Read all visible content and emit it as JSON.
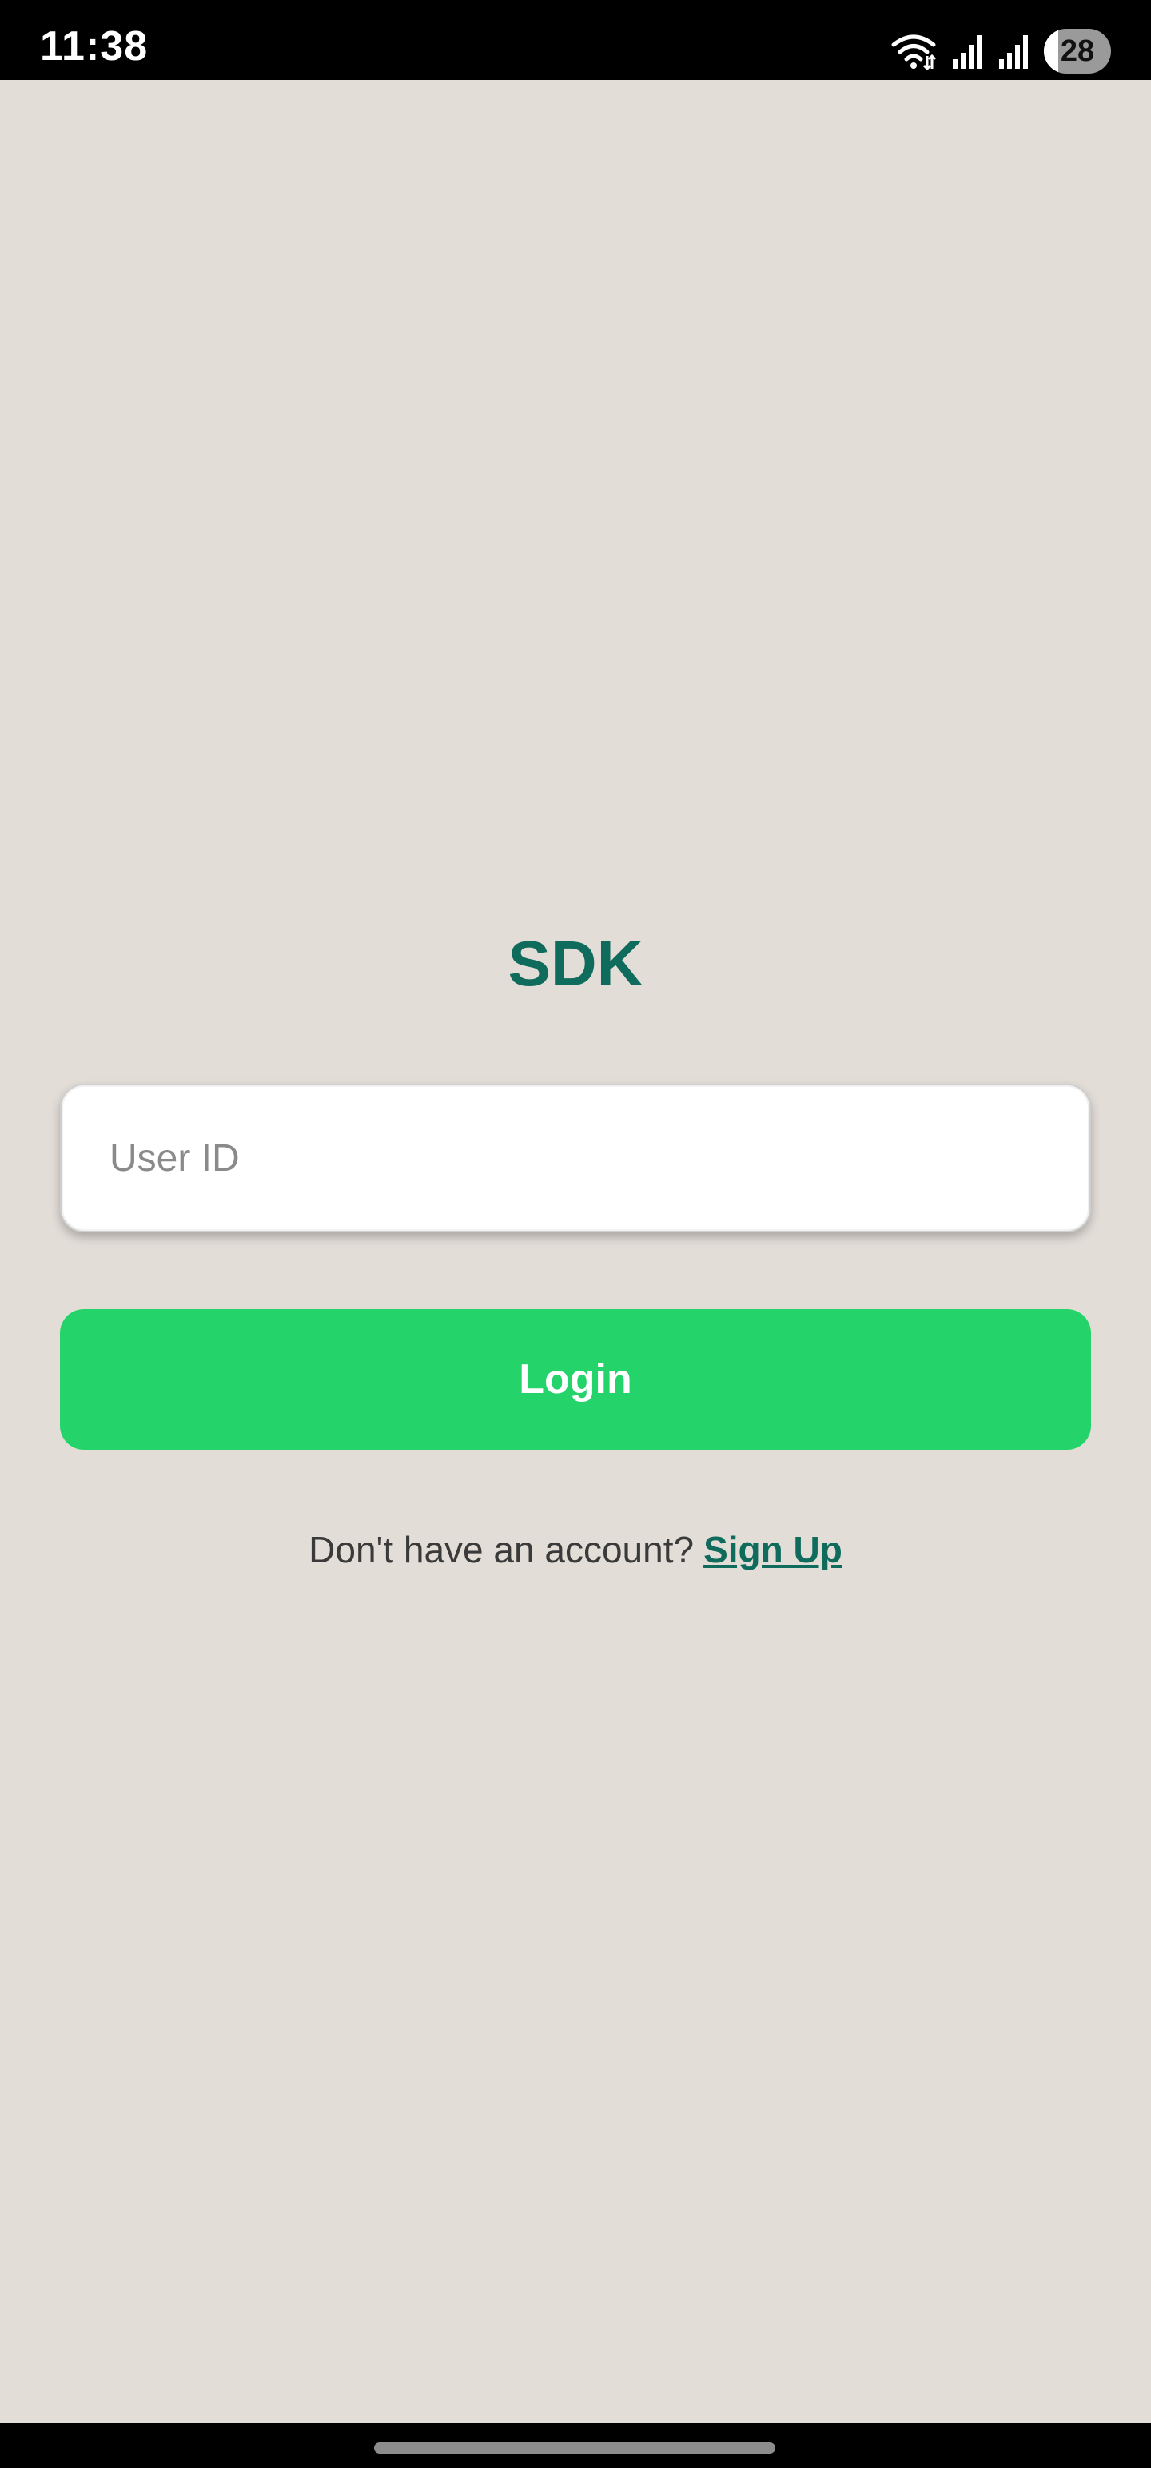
{
  "status_bar": {
    "time": "11:38",
    "battery_level": "28",
    "icons": [
      "wifi-icon",
      "signal-icon",
      "signal-icon",
      "battery-icon"
    ]
  },
  "app": {
    "title": "SDK"
  },
  "login_form": {
    "user_id_placeholder": "User ID",
    "user_id_value": "",
    "login_label": "Login"
  },
  "signup": {
    "prompt": "Don't have an account?",
    "link_label": "Sign Up"
  },
  "colors": {
    "background": "#e3ddd8",
    "brand_teal": "#0f6b5c",
    "login_green": "#25d36b"
  }
}
